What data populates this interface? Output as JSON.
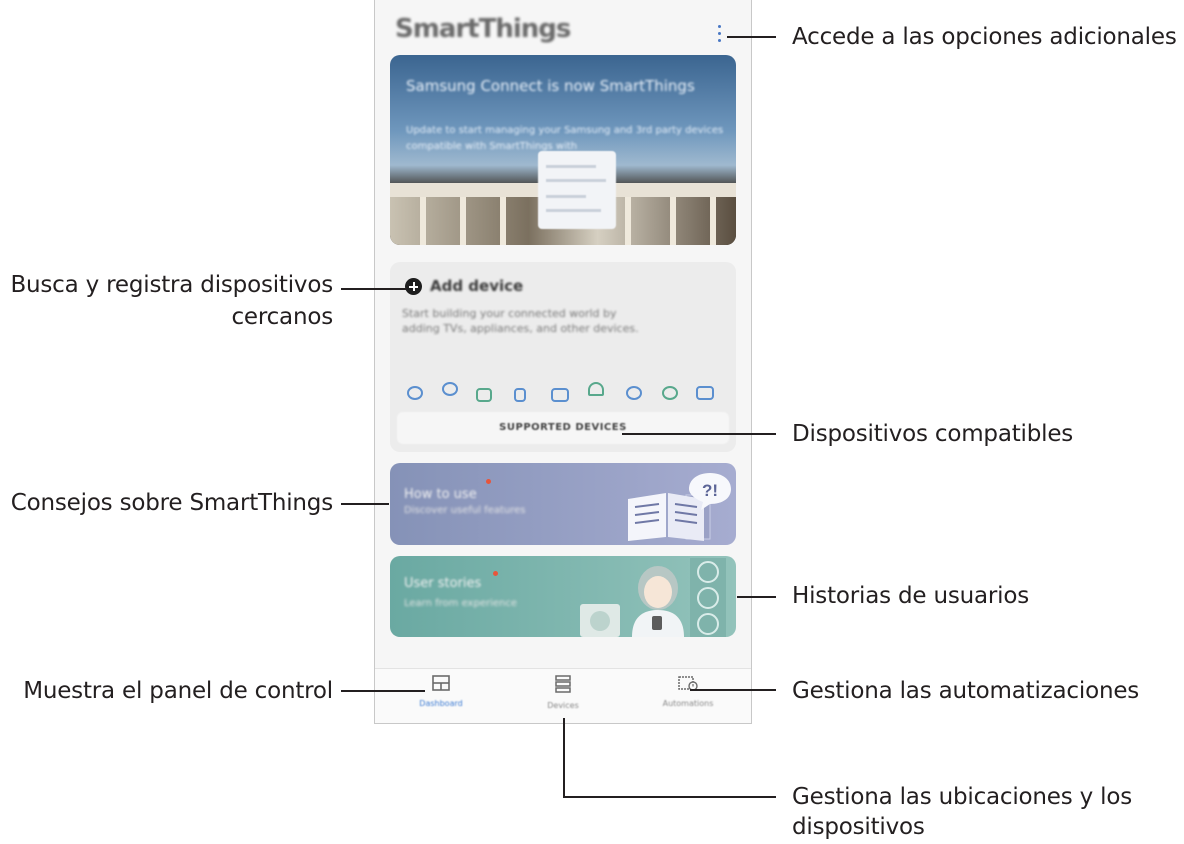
{
  "app": {
    "title": "SmartThings",
    "banner_title": "Samsung Connect is now SmartThings",
    "banner_subtitle": "Update to start managing your Samsung and 3rd party devices compatible with SmartThings with",
    "add_device": {
      "title": "Add device",
      "subtitle": "Start building your connected world by adding TVs, appliances, and other devices."
    },
    "supported_devices": "SUPPORTED DEVICES",
    "how_to_use": {
      "title": "How to use",
      "subtitle": "Discover useful features"
    },
    "user_stories": {
      "title": "User stories",
      "subtitle": "Learn from experience"
    },
    "tabs": [
      {
        "label": "Dashboard",
        "icon": "dashboard-icon",
        "active": true
      },
      {
        "label": "Devices",
        "icon": "devices-icon",
        "active": false
      },
      {
        "label": "Automations",
        "icon": "automations-icon",
        "active": false
      }
    ]
  },
  "callouts": {
    "more_options": "Accede a las opciones adicionales",
    "add_device_1": "Busca y registra dispositivos",
    "add_device_2": "cercanos",
    "supported": "Dispositivos compatibles",
    "tips": "Consejos sobre SmartThings",
    "stories": "Historias de usuarios",
    "dashboard": "Muestra el panel de control",
    "automations": "Gestiona las automatizaciones",
    "devices_1": "Gestiona las ubicaciones y los",
    "devices_2": "dispositivos"
  },
  "colors": {
    "accent": "#3c7bd3",
    "line": "#231f20"
  }
}
